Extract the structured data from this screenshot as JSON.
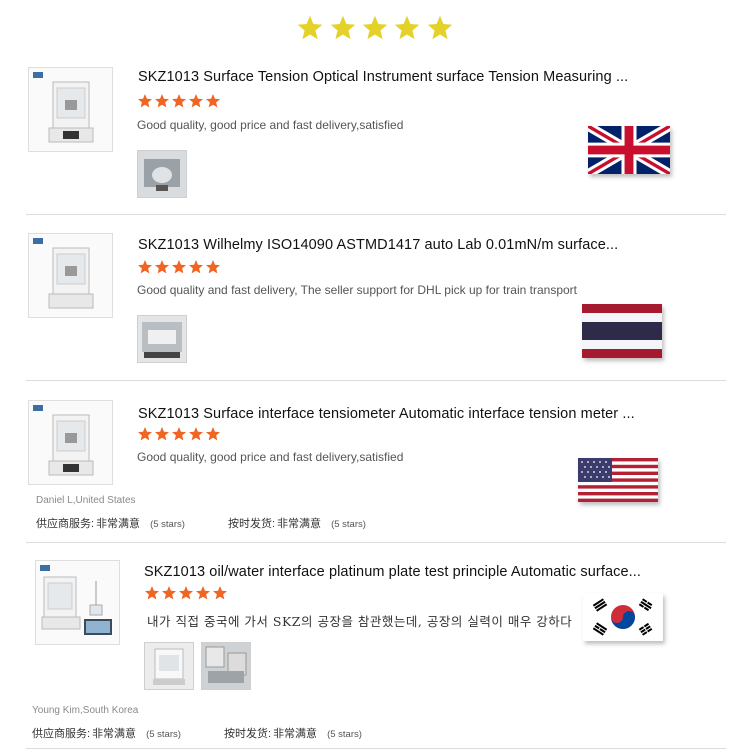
{
  "rating_stars": 5,
  "colors": {
    "header_star": "#e4d22a",
    "row_star": "#f06522"
  },
  "reviews": [
    {
      "title": "SKZ1013 Surface Tension Optical Instrument surface Tension Measuring ...",
      "stars": 5,
      "comment": "Good quality, good price and fast delivery,satisfied",
      "flag": "uk-flag"
    },
    {
      "title": "SKZ1013  Wilhelmy ISO14090 ASTMD1417 auto Lab 0.01mN/m surface...",
      "stars": 5,
      "comment": "Good quality and fast delivery, The seller support for DHL pick up for train transport",
      "flag": "thailand-flag"
    },
    {
      "title": "SKZ1013 Surface interface tensiometer Automatic interface tension meter ...",
      "stars": 5,
      "comment": "Good quality, good price and fast delivery,satisfied",
      "flag": "usa-flag",
      "reviewer": "Daniel L,United States",
      "supplier_label": "供应商服务:",
      "supplier_value": "非常满意",
      "supplier_sub": "(5 stars)",
      "shipping_label": "按时发货:",
      "shipping_value": "非常满意",
      "shipping_sub": "(5 stars)"
    },
    {
      "title": "SKZ1013 oil/water interface platinum plate test principle Automatic surface...",
      "stars": 5,
      "comment": "내가 직접 중국에 가서 SKZ의 공장을 참관했는데, 공장의 실력이 매우 강하다",
      "flag": "south-korea-flag",
      "reviewer": "Young Kim,South Korea",
      "supplier_label": "供应商服务:",
      "supplier_value": "非常满意",
      "supplier_sub": "(5 stars)",
      "shipping_label": "按时发货:",
      "shipping_value": "非常满意",
      "shipping_sub": "(5 stars)"
    }
  ]
}
